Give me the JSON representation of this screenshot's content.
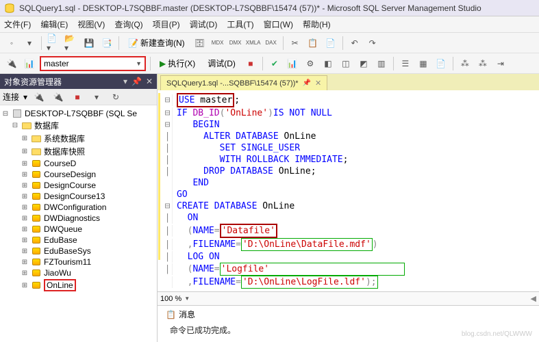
{
  "window": {
    "title": "SQLQuery1.sql - DESKTOP-L7SQBBF.master (DESKTOP-L7SQBBF\\15474 (57))* - Microsoft SQL Server Management Studio"
  },
  "menu": {
    "file": "文件(F)",
    "edit": "编辑(E)",
    "view": "视图(V)",
    "query": "查询(Q)",
    "project": "项目(P)",
    "debug": "调试(D)",
    "tools": "工具(T)",
    "window": "窗口(W)",
    "help": "帮助(H)"
  },
  "toolbar1": {
    "new_query": "新建查询(N)"
  },
  "toolbar2": {
    "database": "master",
    "execute": "执行(X)",
    "debug": "调试(D)"
  },
  "explorer": {
    "title": "对象资源管理器",
    "connect_label": "连接",
    "server": "DESKTOP-L7SQBBF (SQL Se",
    "databases_folder": "数据库",
    "system_db": "系统数据库",
    "db_snapshot": "数据库快照",
    "items": [
      "CourseD",
      "CourseDesign",
      "DesignCourse",
      "DesignCourse13",
      "DWConfiguration",
      "DWDiagnostics",
      "DWQueue",
      "EduBase",
      "EduBaseSys",
      "FZTourism11",
      "JiaoWu",
      "OnLine"
    ]
  },
  "tab": {
    "label": "SQLQuery1.sql -...SQBBF\\15474 (57))*"
  },
  "code": {
    "l1a": "USE",
    "l1b": " master",
    "l2a": "IF",
    "l2b": " DB_ID",
    "l2c": "(",
    "l2d": "'OnLine'",
    "l2e": ")",
    "l2f": "IS NOT NULL",
    "l3": "BEGIN",
    "l4a": "ALTER DATABASE",
    "l4b": " OnLine",
    "l5": "SET SINGLE_USER",
    "l6a": "WITH ROLLBACK IMMEDIATE",
    "l7a": "DROP DATABASE",
    "l7b": " OnLine",
    "l8": "END",
    "l9": "GO",
    "l10a": "CREATE DATABASE",
    "l10b": " OnLine",
    "l11": "ON",
    "l12a": "(",
    "l12b": "NAME",
    "l12c": "=",
    "l12d": "'Datafile'",
    "l13a": ",",
    "l13b": "FILENAME",
    "l13c": "=",
    "l13d": "'D:\\OnLine\\DataFile.mdf'",
    "l13e": ")",
    "l14": "LOG ON",
    "l15a": "(",
    "l15b": "NAME",
    "l15c": "=",
    "l15d": "'Logfile'",
    "l16a": ",",
    "l16b": "FILENAME",
    "l16c": "=",
    "l16d": "'D:\\OnLine\\LogFile.ldf'",
    "l16e": ")",
    "l16f": ";"
  },
  "zoom": {
    "value": "100 %"
  },
  "messages": {
    "tab": "消息",
    "text": "命令已成功完成。"
  },
  "watermark": "blog.csdn.net/QLWWW"
}
